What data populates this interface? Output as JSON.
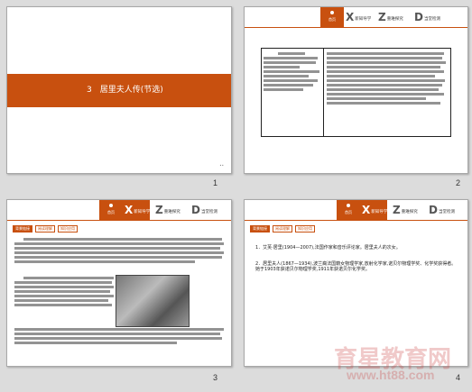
{
  "slides": [
    {
      "number": "1",
      "title": "3　居里夫人传(节选)"
    },
    {
      "number": "2"
    },
    {
      "number": "3",
      "chips": [
        "背景链接",
        "阅读理解",
        "知识应用"
      ]
    },
    {
      "number": "4",
      "chips": [
        "背景链接",
        "阅读理解",
        "知识应用"
      ],
      "para1": "1．艾芙·居里(1904—2007),法国作家和音乐评论家。居里夫人的次女。",
      "para2": "2．居里夫人(1867—1934),波兰裔法国籍女物理学家,放射化学家,诺贝尔物理学奖、化学奖获得者。她于1903年获诺贝尔物理学奖,1911年获诺贝尔化学奖。"
    }
  ],
  "nav": {
    "home_label": "首页",
    "items": [
      {
        "letter": "X",
        "label": "新知导学"
      },
      {
        "letter": "Z",
        "label": "重难探究"
      },
      {
        "letter": "D",
        "label": "当堂检测"
      }
    ]
  },
  "watermark": {
    "text": "育星教育网",
    "url": "www.ht88.com"
  }
}
